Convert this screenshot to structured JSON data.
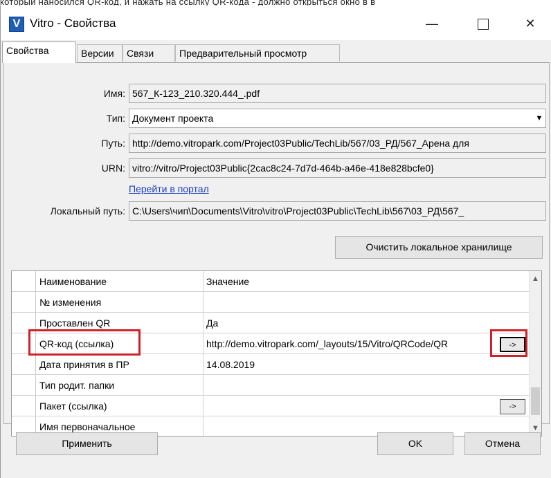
{
  "top_caption": "который наносился QR-код, и нажать на ссылку QR-кода - должно открыться окно в в",
  "window": {
    "app_icon_letter": "V",
    "title": "Vitro - Свойства",
    "min_glyph": "—",
    "close_glyph": "✕"
  },
  "tabs": [
    {
      "label": "Свойства",
      "active": true
    },
    {
      "label": "Версии",
      "active": false
    },
    {
      "label": "Связи",
      "active": false
    },
    {
      "label": "Предварительный просмотр",
      "active": false
    }
  ],
  "properties": {
    "name_label": "Имя:",
    "name_value": "567_К-123_210.320.444_.pdf",
    "type_label": "Тип:",
    "type_value": "Документ проекта",
    "path_label": "Путь:",
    "path_value": "http://demo.vitropark.com/Project03Public/TechLib/567/03_РД/567_Арена для",
    "urn_label": "URN:",
    "urn_value": "vitro://vitro/Project03Public{2cac8c24-7d7d-464b-a46e-418e828bcfe0}",
    "portal_link": "Перейти в портал",
    "local_path_label": "Локальный путь:",
    "local_path_value": "C:\\Users\\чип\\Documents\\Vitro\\vitro\\Project03Public\\TechLib\\567\\03_РД\\567_",
    "clear_cache_button": "Очистить локальное хранилище"
  },
  "grid": {
    "columns": [
      "Наименование",
      "Значение"
    ],
    "rows": [
      {
        "name": "№ изменения",
        "value": "",
        "button": ""
      },
      {
        "name": "Проставлен QR",
        "value": "Да",
        "button": ""
      },
      {
        "name": "QR-код  (ссылка)",
        "value": "http://demo.vitropark.com/_layouts/15/Vitro/QRCode/QR",
        "button": "->"
      },
      {
        "name": "Дата принятия в ПР",
        "value": "14.08.2019",
        "button": ""
      },
      {
        "name": "Тип родит. папки",
        "value": "",
        "button": ""
      },
      {
        "name": "Пакет (ссылка)",
        "value": "",
        "button": "->"
      },
      {
        "name": "Имя первоначальное",
        "value": "",
        "button": ""
      }
    ]
  },
  "footer": {
    "apply_button": "Применить",
    "ok_button": "OK",
    "cancel_button": "Отмена"
  },
  "colors": {
    "highlight": "#d0202a",
    "link": "#1a3dc8",
    "app_icon": "#1f5fb5"
  },
  "icons": [
    "app-logo-icon",
    "minimize-icon",
    "maximize-icon",
    "close-icon",
    "dropdown-arrow-icon",
    "scroll-up-icon",
    "scroll-down-icon"
  ]
}
